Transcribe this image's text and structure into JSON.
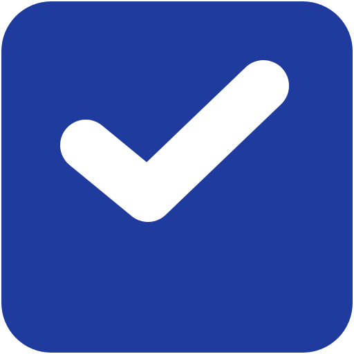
{
  "checkbox": {
    "state": "checked",
    "icon": "checkmark-icon",
    "colors": {
      "box": "#1E3B9D",
      "check": "#FFFFFF"
    }
  }
}
